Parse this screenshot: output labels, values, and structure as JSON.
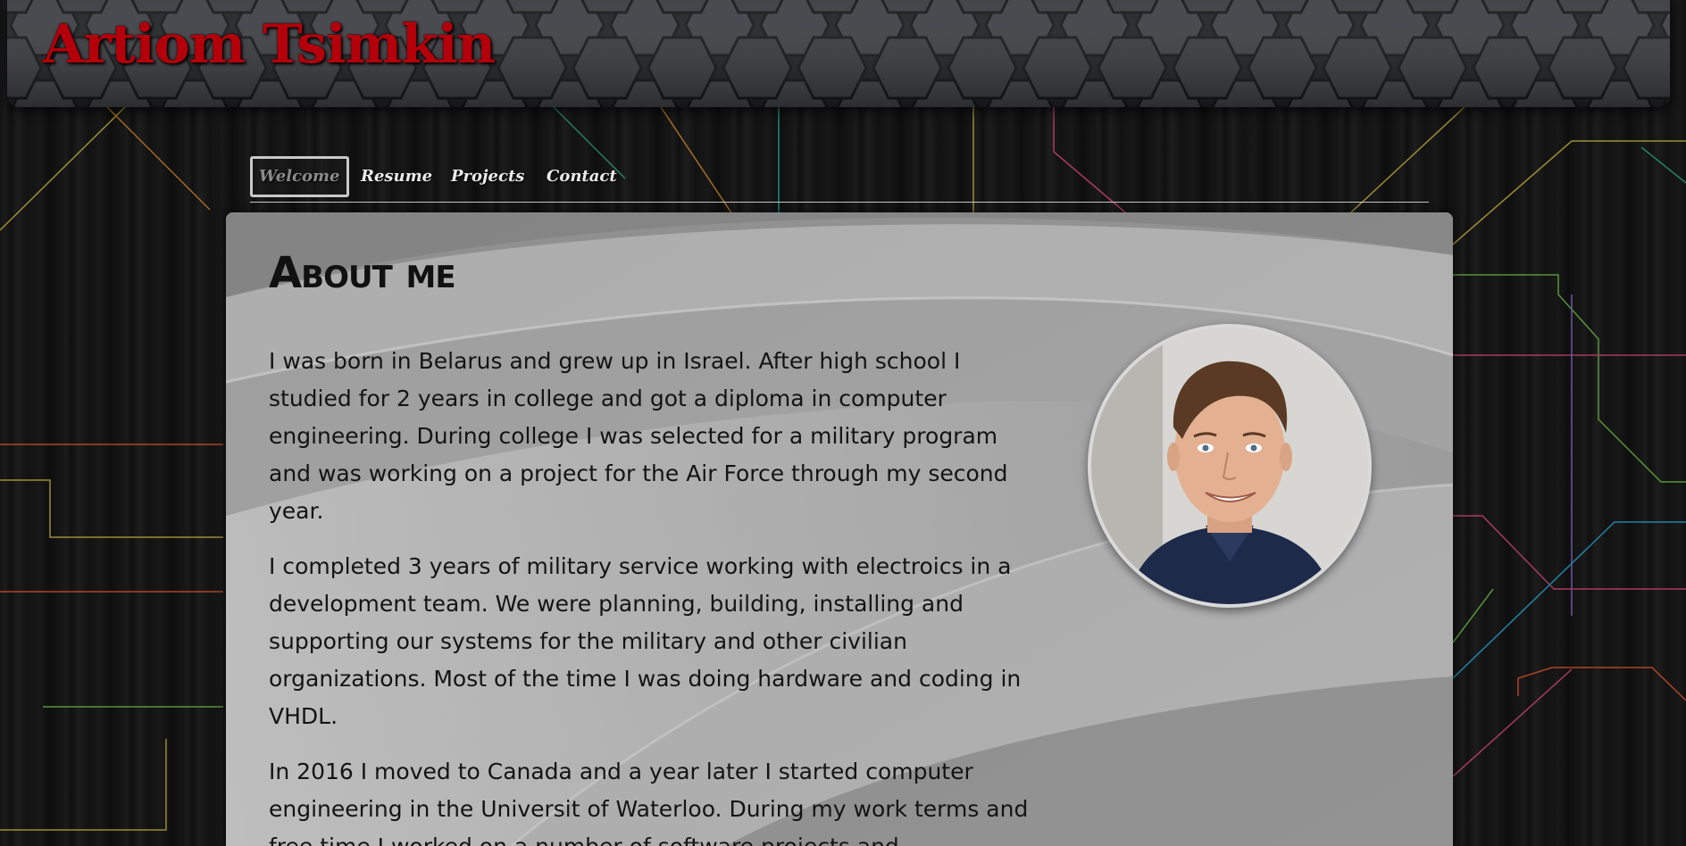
{
  "header": {
    "site_title": "Artiom Tsimkin"
  },
  "nav": {
    "items": [
      {
        "label": "Welcome",
        "active": true
      },
      {
        "label": "Resume",
        "active": false
      },
      {
        "label": "Projects",
        "active": false
      },
      {
        "label": "Contact",
        "active": false
      }
    ]
  },
  "main": {
    "heading": "About me",
    "paragraphs": [
      "I was born in Belarus and grew up in Israel. After high school I studied for 2 years in college and got a diploma in computer engineering. During college I was selected for a military program and was working on a project for the Air Force through my second year.",
      "I completed 3 years of military service working with electroics in a development team. We were planning, building, installing and supporting our systems for the military and other civilian organizations. Most of the time I was doing hardware and coding in VHDL.",
      "In 2016 I moved to Canada and a year later I started computer engineering in the Universit of Waterloo. During my work terms and free time I worked on a number of software projects and"
    ],
    "photo_icon": "profile-photo"
  },
  "colors": {
    "title_red": "#b3000a",
    "panel_gray": "#9b9b9b",
    "nav_border": "#c9c9c9"
  }
}
